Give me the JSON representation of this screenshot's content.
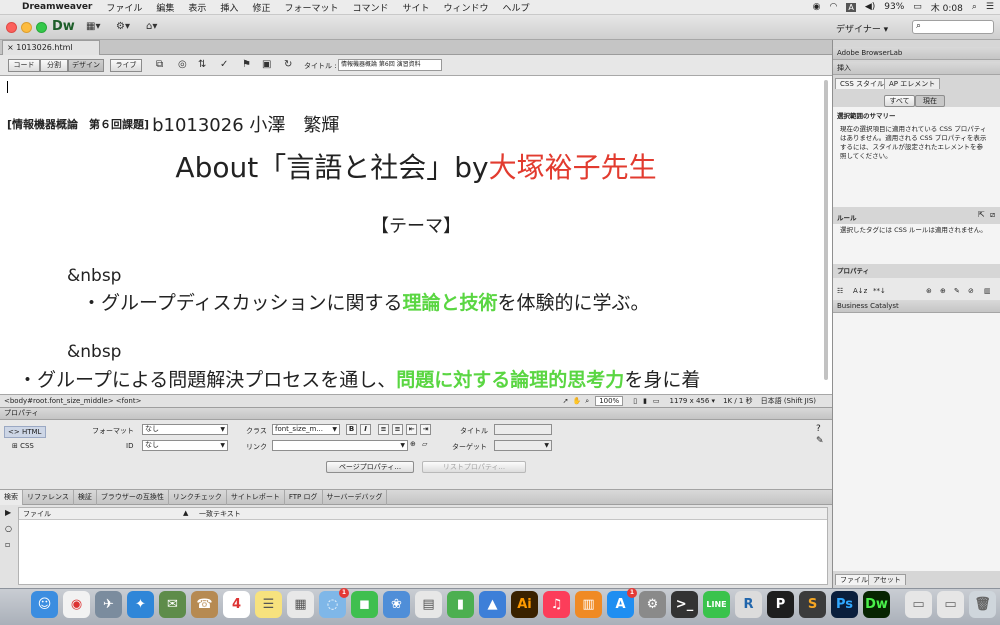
{
  "menubar": {
    "app_name": "Dreamweaver",
    "items": [
      "ファイル",
      "編集",
      "表示",
      "挿入",
      "修正",
      "フォーマット",
      "コマンド",
      "サイト",
      "ウィンドウ",
      "ヘルプ"
    ],
    "battery": "93%",
    "clock": "木 0:08"
  },
  "appbar": {
    "logo": "Dw",
    "workspace": "デザイナー ▾",
    "search_placeholder": ""
  },
  "document": {
    "tab_label": "1013026.html (XHTML)",
    "view_buttons": [
      "コード",
      "分割",
      "デザイン",
      "ライブ"
    ],
    "title_label": "タイトル :",
    "title_value": "情報機器概論 第6回 演習資料",
    "course_bracket": "[情報機器概論　第６回課題]",
    "student_info": "b1013026 小澤　繁輝",
    "heading_prefix": "About「言語と社会」by",
    "heading_teacher": "大塚裕子先生",
    "theme": "【テーマ】",
    "nbsp_1": "&nbsp",
    "bullet_1_a": "・グループディスカッションに関する",
    "bullet_1_b": "理論と技術",
    "bullet_1_c": "を体験的に学ぶ。",
    "nbsp_2": "&nbsp",
    "bullet_2_a": "・グループによる問題解決プロセスを通し、",
    "bullet_2_b": "問題に対する論理的思考力",
    "bullet_2_c": "を身に着"
  },
  "statusbar": {
    "tag_path": "<body#root.font_size_middle> <font>",
    "zoom": "100%",
    "dimensions": "1179 x 456 ▾",
    "size_time": "1K / 1 秒",
    "encoding": "日本語 (Shift JIS)"
  },
  "properties": {
    "header": "プロパティ",
    "html_label": "HTML",
    "css_label": "CSS",
    "format_label": "フォーマット",
    "format_value": "なし",
    "class_label": "クラス",
    "class_value": "font_size_m...",
    "id_label": "ID",
    "id_value": "なし",
    "link_label": "リンク",
    "title_label": "タイトル",
    "target_label": "ターゲット",
    "bold": "B",
    "italic": "I",
    "page_props_button": "ページプロパティ...",
    "list_props_button": "リストプロパティ..."
  },
  "results": {
    "tabs": [
      "検索",
      "リファレンス",
      "検証",
      "ブラウザーの互換性",
      "リンクチェック",
      "サイトレポート",
      "FTP ログ",
      "サーバーデバッグ"
    ],
    "col_file": "ファイル",
    "col_match": "一致テキスト"
  },
  "right_panel": {
    "browserlab": "Adobe BrowserLab",
    "insert": "挿入",
    "css_tab": "CSS スタイル",
    "ap_tab": "AP エレメント",
    "all_btn": "すべて",
    "current_btn": "現在",
    "summary_title": "選択範囲のサマリー",
    "summary_text": "現在の選択項目に適用されている CSS プロパティはありません。適用される CSS プロパティを表示するには、スタイルが設定されたエレメントを参照してください。",
    "rules_title": "ルール",
    "rules_text": "選択したタグには CSS ルールは適用されません。",
    "properties_title": "プロパティ",
    "business_catalyst": "Business Catalyst",
    "files_tab": "ファイル",
    "assets_tab": "アセット"
  },
  "dock": {
    "calendar_day": "4",
    "badge_count": "1"
  }
}
